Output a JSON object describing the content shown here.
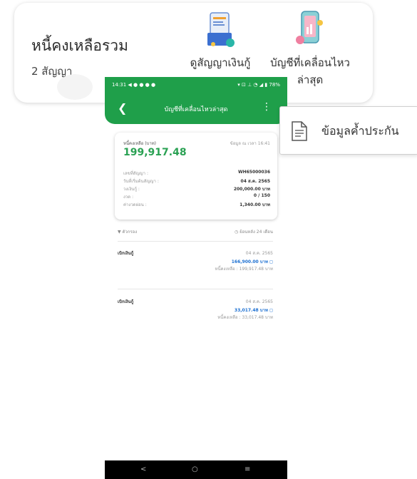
{
  "summary": {
    "title": "หนี้คงเหลือรวม",
    "contract_count": "2 สัญญา",
    "actions": [
      {
        "label": "ดูสัญญาเงินกู้",
        "icon": "loan-contract-icon"
      },
      {
        "label": "บัญชีที่เคลื่อนไหว",
        "label2": "ล่าสุด",
        "icon": "recent-transactions-icon"
      }
    ]
  },
  "phone": {
    "status_left": "14:31 ◀ ● ● ● ●",
    "status_right": "▾ ⊡ ⊥ ◔ ◢ ▮ 78%",
    "header_title": "บัญชีที่เคลื่อนไหวล่าสุด",
    "card": {
      "label": "หนี้คงเหลือ (บาท)",
      "link": "ข้อมูล ณ เวลา 16:41",
      "amount": "199,917.48",
      "rows": [
        {
          "k": "เลขที่สัญญา :",
          "v": "WH65000036"
        },
        {
          "k": "วันที่เริ่มต้นสัญญา :",
          "v": "04 ส.ค. 2565"
        },
        {
          "k": "วงเงินกู้ :",
          "v": "200,000.00 บาท"
        },
        {
          "k": "งวด :",
          "v": "0 / 150"
        },
        {
          "k": "ค่างวดผ่อน :",
          "v": "1,340.00 บาท"
        }
      ]
    },
    "filter_label": "ตัวกรอง",
    "period_label": "ย้อนหลัง 24 เดือน",
    "transactions": [
      {
        "type": "เบิกเงินกู้",
        "date": "04 ส.ค. 2565",
        "amount": "166,900.00 บาท",
        "balance": "หนี้คงเหลือ : 199,917.48 บาท"
      },
      {
        "type": "เบิกเงินกู้",
        "date": "04 ส.ค. 2565",
        "amount": "33,017.48 บาท",
        "balance": "หนี้คงเหลือ : 33,017.48 บาท"
      }
    ],
    "nav": [
      "<",
      "○",
      "≡"
    ]
  },
  "popup": {
    "label": "ข้อมูลค้ำประกัน",
    "icon": "document-icon"
  },
  "colors": {
    "brand_green": "#1f9f4a",
    "amount_green": "#2aa153",
    "amount_blue": "#1b6fd1"
  }
}
